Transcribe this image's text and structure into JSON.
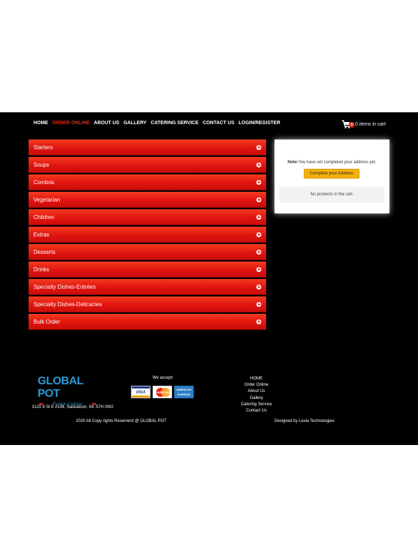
{
  "nav": {
    "items": [
      "HOME",
      "ORDER ONLINE",
      "ABOUT US",
      "GALLERY",
      "CATERING SERVICE",
      "CONTACT US",
      "LOGIN/REGISTER"
    ],
    "active": "ORDER ONLINE"
  },
  "cart": {
    "count": "0",
    "label": "0 items in cart"
  },
  "menu": {
    "categories": [
      "Starters",
      "Soups",
      "Combos",
      "Vegetarian",
      "Children",
      "Extras",
      "Desserts",
      "Drinks",
      "Specialty Dishes-Entrées",
      "Specialty Dishes-Delicacies",
      "Bulk Order"
    ]
  },
  "cart_panel": {
    "note_label": "Note:",
    "note_text": "You have not completed your address yet.",
    "button_label": "Complete your Address",
    "empty_text": "No products in the cart."
  },
  "footer": {
    "logo_title": "GLOBAL POT",
    "logo_subtitle": "Fusion Cuisine",
    "address": "3120 8 St E #106, Saskatoon, SK S7H 0W2",
    "accept_label": "We accept:",
    "cards": [
      "VISA",
      "MasterCard",
      "AMERICAN EXPRESS"
    ],
    "links": [
      "HOME",
      "Order Online",
      "About Us",
      "Gallery",
      "Catering Service",
      "Contact Us"
    ],
    "copyright": "2020 All Copy rights Reserverd @ GLOBAL POT",
    "designed_by": "Designed by Lexia Technologies"
  },
  "colors": {
    "accent": "#e52817",
    "background": "#000000",
    "button": "#f3b10c",
    "logo": "#2a9bd5"
  }
}
